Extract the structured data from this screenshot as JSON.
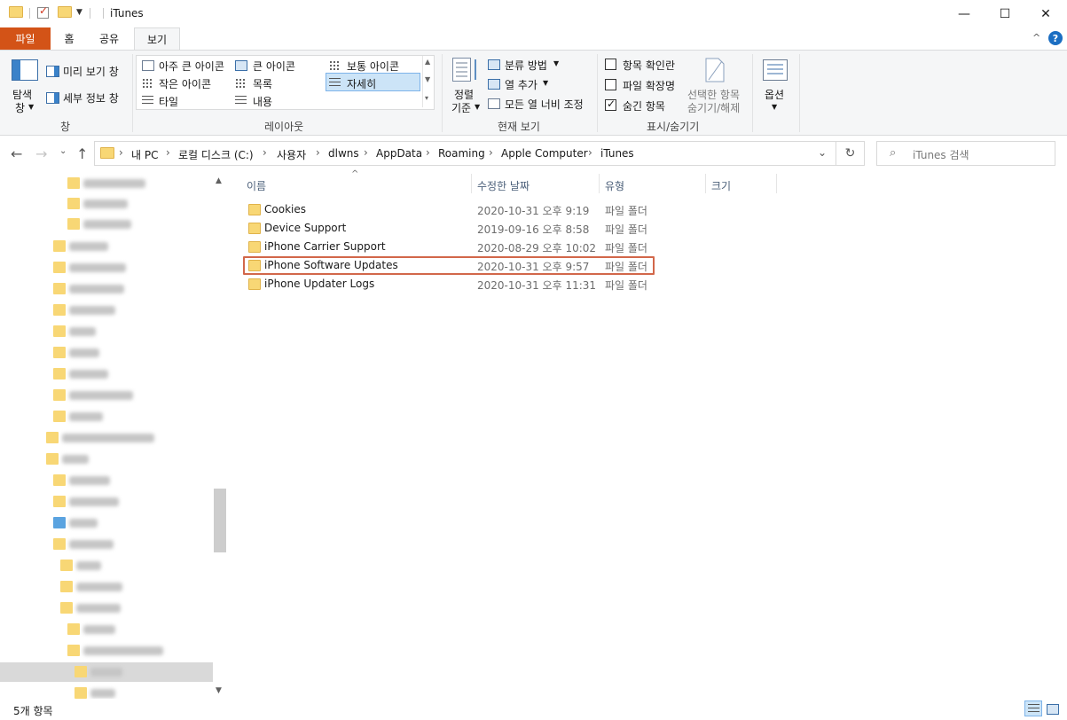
{
  "window": {
    "title": "iTunes",
    "minimize": "—",
    "maximize": "☐",
    "close": "✕"
  },
  "ribbon_tabs": {
    "file": "파일",
    "home": "홈",
    "share": "공유",
    "view": "보기"
  },
  "ribbon": {
    "pane_group": {
      "nav_pane_line1": "탐색",
      "nav_pane_line2": "창",
      "preview": "미리 보기 창",
      "details": "세부 정보 창",
      "label": "창"
    },
    "layout_group": {
      "extra_large": "아주 큰 아이콘",
      "large": "큰 아이콘",
      "medium": "보통 아이콘",
      "small": "작은 아이콘",
      "list": "목록",
      "details": "자세히",
      "tiles": "타일",
      "content": "내용",
      "label": "레이아웃"
    },
    "current_view_group": {
      "sort_line1": "정렬",
      "sort_line2": "기준",
      "group_by": "분류 방법",
      "add_columns": "열 추가",
      "size_all": "모든 열 너비 조정",
      "label": "현재 보기"
    },
    "show_hide_group": {
      "item_checkboxes": "항목 확인란",
      "file_extensions": "파일 확장명",
      "hidden_items": "숨긴 항목",
      "hide_selected_line1": "선택한 항목",
      "hide_selected_line2": "숨기기/해제",
      "label": "표시/숨기기"
    },
    "options": {
      "label": "옵션"
    }
  },
  "address_bar": {
    "breadcrumbs": [
      "내 PC",
      "로컬 디스크 (C:)",
      "사용자",
      "dlwns",
      "AppData",
      "Roaming",
      "Apple Computer",
      "iTunes"
    ]
  },
  "search": {
    "placeholder": "iTunes 검색"
  },
  "columns": {
    "name": "이름",
    "date": "수정한 날짜",
    "type": "유형",
    "size": "크기"
  },
  "files": [
    {
      "name": "Cookies",
      "date": "2020-10-31 오후 9:19",
      "type": "파일 폴더"
    },
    {
      "name": "Device Support",
      "date": "2019-09-16 오후 8:58",
      "type": "파일 폴더"
    },
    {
      "name": "iPhone Carrier Support",
      "date": "2020-08-29 오후 10:02",
      "type": "파일 폴더"
    },
    {
      "name": "iPhone Software Updates",
      "date": "2020-10-31 오후 9:57",
      "type": "파일 폴더"
    },
    {
      "name": "iPhone Updater Logs",
      "date": "2020-10-31 오후 11:31",
      "type": "파일 폴더"
    }
  ],
  "status": {
    "item_count": "5개 항목"
  },
  "colors": {
    "file_tab": "#d35317",
    "highlight_border": "#d2674a",
    "folder": "#f8d775",
    "selection": "#cce4f7"
  }
}
